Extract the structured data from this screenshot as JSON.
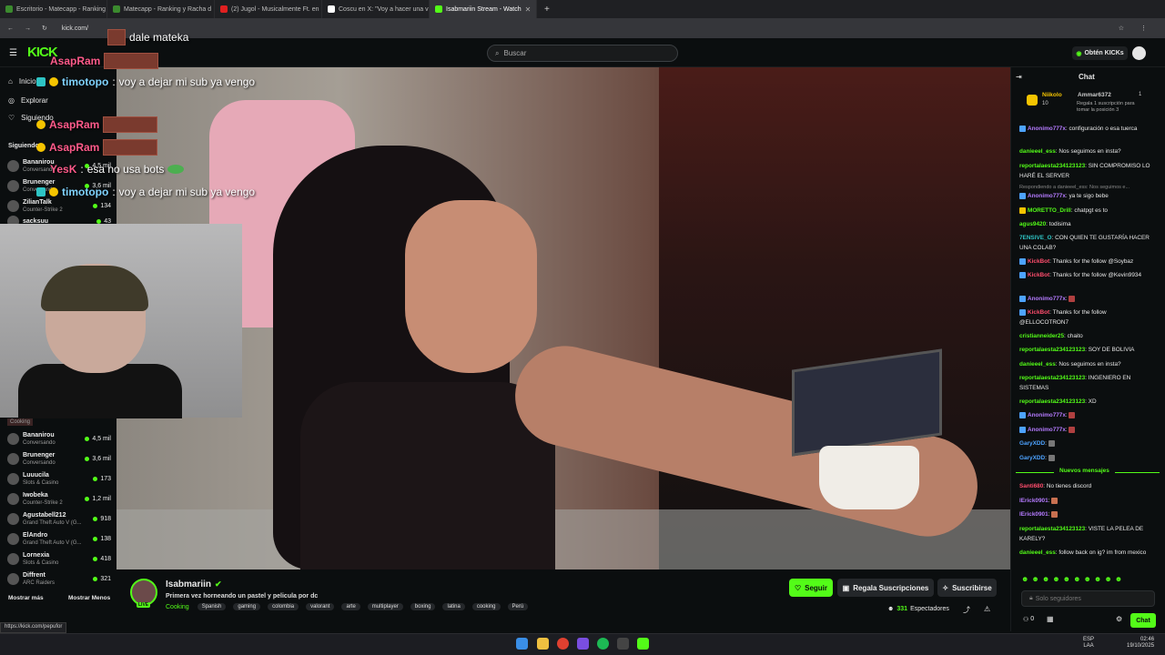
{
  "browser": {
    "tabs": [
      {
        "label": "Escritorio - Matecapp - Ranking",
        "color": "#3b8a2e"
      },
      {
        "label": "Matecapp - Ranking y Racha d",
        "color": "#3b8a2e"
      },
      {
        "label": "(2) Jugol - Musicalmente Ft. en",
        "color": "#e02020"
      },
      {
        "label": "Coscu en X: \"Voy a hacer una v",
        "color": "#ffffff"
      },
      {
        "label": "Isabmariin Stream - Watch",
        "color": "#53fc18"
      }
    ],
    "url": "kick.com/",
    "status_url": "https://kick.com/pepufor"
  },
  "header": {
    "logo": "KICK",
    "search_placeholder": "Buscar",
    "kicks_button": "Obtén KICKs"
  },
  "sidebar": {
    "nav": [
      "Inicio",
      "Explorar",
      "Siguiendo"
    ],
    "section_label": "Siguiendo",
    "following_top": [
      {
        "name": "Bananirou",
        "game": "Conversando",
        "viewers": "4,5 mil"
      },
      {
        "name": "Brunenger",
        "game": "Conversando",
        "viewers": "3,6 mil"
      },
      {
        "name": "ZilianTalk",
        "game": "Counter-Strike 2",
        "viewers": "134"
      },
      {
        "name": "sacksuu",
        "game": "",
        "viewers": "43"
      }
    ],
    "following": [
      {
        "name": "Bananirou",
        "game": "Conversando",
        "viewers": "4,5 mil"
      },
      {
        "name": "Brunenger",
        "game": "Conversando",
        "viewers": "3,6 mil"
      },
      {
        "name": "Luuucila",
        "game": "Slots & Casino",
        "viewers": "173"
      },
      {
        "name": "Iwobeka",
        "game": "Counter-Strike 2",
        "viewers": "1,2 mil"
      },
      {
        "name": "Agustabell212",
        "game": "Grand Theft Auto V (G...",
        "viewers": "918"
      },
      {
        "name": "ElAndro",
        "game": "Grand Theft Auto V (G...",
        "viewers": "138"
      },
      {
        "name": "Lornexia",
        "game": "Slots & Casino",
        "viewers": "418"
      },
      {
        "name": "Diffrent",
        "game": "ARC Raiders",
        "viewers": "321"
      }
    ],
    "cooking_label": "Cooking",
    "show_more": "Mostrar más",
    "show_less": "Mostrar Menos"
  },
  "overlay_chat": [
    {
      "user": "",
      "text": "dale mateka"
    },
    {
      "user": "AsapRam",
      "text": ""
    },
    {
      "user": "timotopo",
      "text": "voy a dejar mi sub ya vengo"
    },
    {
      "user": "AsapRam",
      "text": ""
    },
    {
      "user": "AsapRam",
      "text": ""
    },
    {
      "user": "YesK",
      "text": "esa no usa bots"
    },
    {
      "user": "timotopo",
      "text": "voy a dejar mi sub ya vengo"
    }
  ],
  "stream": {
    "channel": "Isabmariin",
    "title": "Primera vez horneando un pastel y pelicula por dc",
    "category": "Cooking",
    "tags": [
      "Spanish",
      "gaming",
      "colombia",
      "valorant",
      "arte",
      "multiplayer",
      "boxing",
      "latina",
      "cooking",
      "Perú"
    ],
    "follow_button": "Seguir",
    "gift_button": "Regala Suscripciones",
    "subscribe_button": "Suscribirse",
    "viewers": "331",
    "viewers_label": "Espectadores",
    "live_badge": "LIVE"
  },
  "chat": {
    "title": "Chat",
    "leaderboard": [
      {
        "name": "Niikolo",
        "count": "10"
      },
      {
        "name": "Ammar6372",
        "count": "1"
      }
    ],
    "leaderboard_note": "Regala 1 suscripción para tomar la posición 3",
    "messages": [
      {
        "user": "Anonimo777x",
        "color": "#b57bff",
        "text": "configuración o esa tuerca"
      },
      {
        "user": "danieeel_ess",
        "color": "#53fc18",
        "text": "Nos seguimos en insta?"
      },
      {
        "user": "reportalaesta234123123",
        "color": "#53fc18",
        "text": "SIN COMPROMISO LO HARÉ EL SERVER"
      },
      {
        "user": "",
        "color": "#888888",
        "text": "Respondiendo a danieeel_ess: Nos seguimos e..."
      },
      {
        "user": "Anonimo777x",
        "color": "#b57bff",
        "text": "ya te sigo bebe"
      },
      {
        "user": "MORETTO_Drill",
        "color": "#53fc18",
        "text": "chatpgt es to"
      },
      {
        "user": "agus9420",
        "color": "#53fc18",
        "text": "todisima"
      },
      {
        "user": "7ENSIVE_O",
        "color": "#2ec4c4",
        "text": "CON QUIEN TE GUSTARÍA HACER UNA COLAB?"
      },
      {
        "user": "KickBot",
        "color": "#ff4d6d",
        "text": "Thanks for the follow @Soybaz"
      },
      {
        "user": "KickBot",
        "color": "#ff4d6d",
        "text": "Thanks for the follow @Kevin9934"
      },
      {
        "user": "Anonimo777x",
        "color": "#b57bff",
        "text": ""
      },
      {
        "user": "KickBot",
        "color": "#ff4d6d",
        "text": "Thanks for the follow @ELLOCOTRON7"
      },
      {
        "user": "cristianneider25",
        "color": "#53fc18",
        "text": "chaito"
      },
      {
        "user": "reportalaesta234123123",
        "color": "#53fc18",
        "text": "SOY DE BOLIVIA"
      },
      {
        "user": "danieeel_ess",
        "color": "#53fc18",
        "text": "Nos seguimos en insta?"
      },
      {
        "user": "reportalaesta234123123",
        "color": "#53fc18",
        "text": "INGENIERO EN SISTEMAS"
      },
      {
        "user": "reportalaesta234123123",
        "color": "#53fc18",
        "text": "XD"
      },
      {
        "user": "Anonimo777x",
        "color": "#b57bff",
        "text": ""
      },
      {
        "user": "Anonimo777x",
        "color": "#b57bff",
        "text": ""
      },
      {
        "user": "GaryXDD",
        "color": "#4da3ff",
        "text": ""
      },
      {
        "user": "GaryXDD",
        "color": "#4da3ff",
        "text": ""
      }
    ],
    "new_messages_label": "Nuevos mensajes",
    "new_messages": [
      {
        "user": "Santi680",
        "color": "#ff4d6d",
        "text": "No tienes discord"
      },
      {
        "user": "lErick0901",
        "color": "#b57bff",
        "text": ""
      },
      {
        "user": "lErick0901",
        "color": "#b57bff",
        "text": ""
      },
      {
        "user": "reportalaesta234123123",
        "color": "#53fc18",
        "text": "VISTE LA PELEA DE KARELY?"
      },
      {
        "user": "danieeel_ess",
        "color": "#53fc18",
        "text": "follow back on ig? im from mexico"
      }
    ],
    "input_placeholder": "Solo seguidores",
    "send_button": "Chat",
    "points": "0"
  },
  "taskbar": {
    "lang": "ESP",
    "lang_sub": "LAA",
    "time": "02:46",
    "date": "19/10/2025"
  },
  "colors": {
    "accent": "#53fc18",
    "bg": "#0b0e0f"
  }
}
